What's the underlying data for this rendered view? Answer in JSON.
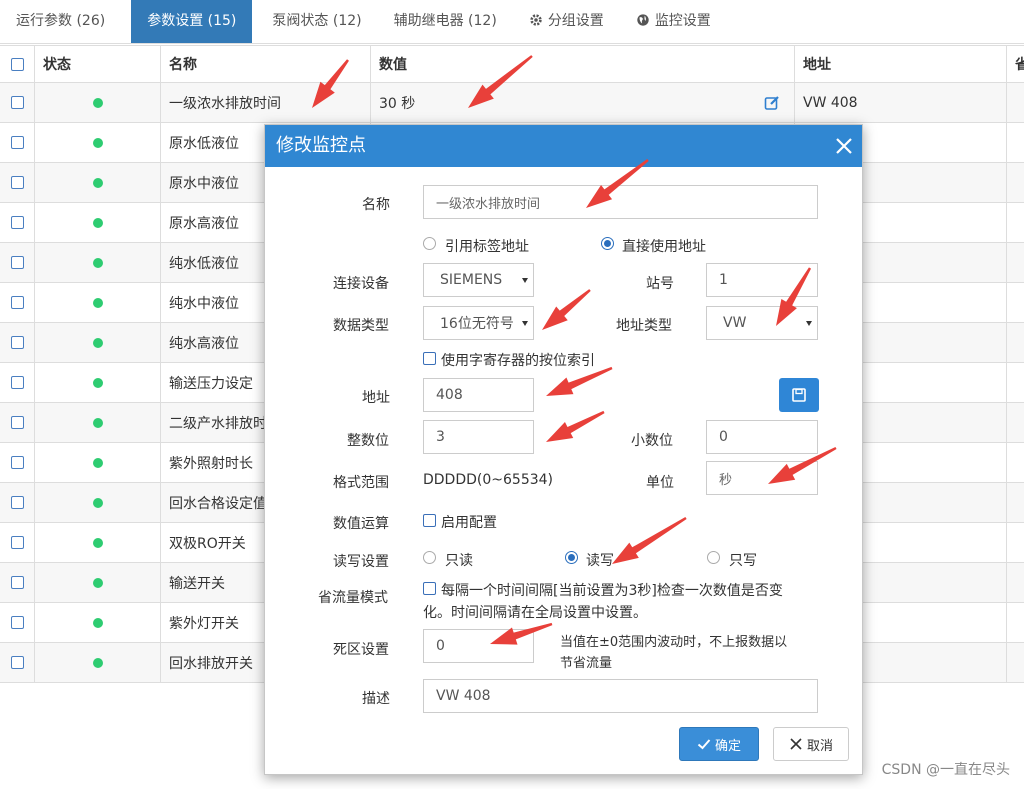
{
  "tabs": [
    {
      "label": "运行参数 (26)",
      "icon": ""
    },
    {
      "label": "参数设置 (15)",
      "icon": "",
      "active": true
    },
    {
      "label": "泵阀状态 (12)",
      "icon": ""
    },
    {
      "label": "辅助继电器 (12)",
      "icon": ""
    },
    {
      "label": "分组设置",
      "icon": "gear-icon"
    },
    {
      "label": "监控设置",
      "icon": "globe-icon"
    }
  ],
  "table": {
    "headers": {
      "status": "状态",
      "name": "名称",
      "value": "数值",
      "address": "地址",
      "more": "省"
    },
    "rows": [
      {
        "name": "一级浓水排放时间",
        "value": "30 秒",
        "address": "VW 408"
      },
      {
        "name": "原水低液位"
      },
      {
        "name": "原水中液位"
      },
      {
        "name": "原水高液位"
      },
      {
        "name": "纯水低液位"
      },
      {
        "name": "纯水中液位"
      },
      {
        "name": "纯水高液位"
      },
      {
        "name": "输送压力设定"
      },
      {
        "name": "二级产水排放时"
      },
      {
        "name": "紫外照射时长"
      },
      {
        "name": "回水合格设定值"
      },
      {
        "name": "双极RO开关"
      },
      {
        "name": "输送开关"
      },
      {
        "name": "紫外灯开关"
      },
      {
        "name": "回水排放开关"
      }
    ],
    "status_color": "#2ecc71"
  },
  "modal": {
    "title": "修改监控点",
    "header_color": "#3087d2",
    "name_label": "名称",
    "name_value": "一级浓水排放时间",
    "address_mode": {
      "option_tag": "引用标签地址",
      "option_direct": "直接使用地址",
      "selected": "direct"
    },
    "device_label": "连接设备",
    "device_value": "SIEMENS",
    "station_label": "站号",
    "station_value": "1",
    "datatype_label": "数据类型",
    "datatype_value": "16位无符号",
    "addrtype_label": "地址类型",
    "addrtype_value": "VW",
    "bitindex_label": "使用字寄存器的按位索引",
    "address_label": "地址",
    "address_value": "408",
    "integer_label": "整数位",
    "integer_value": "3",
    "decimal_label": "小数位",
    "decimal_value": "0",
    "format_label": "格式范围",
    "format_value": "DDDDD(0~65534)",
    "unit_label": "单位",
    "unit_value": "秒",
    "calc_label": "数值运算",
    "calc_option": "启用配置",
    "rw_label": "读写设置",
    "rw_readonly": "只读",
    "rw_readwrite": "读写",
    "rw_writeonly": "只写",
    "rw_selected": "readwrite",
    "flow_label": "省流量模式",
    "flow_text_line1": "每隔一个时间间隔[当前设置为3秒]检查一次数值是否变",
    "flow_text_line2": "化。时间间隔请在全局设置中设置。",
    "deadband_label": "死区设置",
    "deadband_value": "0",
    "deadband_hint_line1": "当值在±0范围内波动时，不上报数据以",
    "deadband_hint_line2": "节省流量",
    "desc_label": "描述",
    "desc_value": "VW 408",
    "ok_label": "确定",
    "cancel_label": "取消"
  },
  "annotation_color": "#e8403a",
  "watermark": "CSDN @一直在尽头"
}
